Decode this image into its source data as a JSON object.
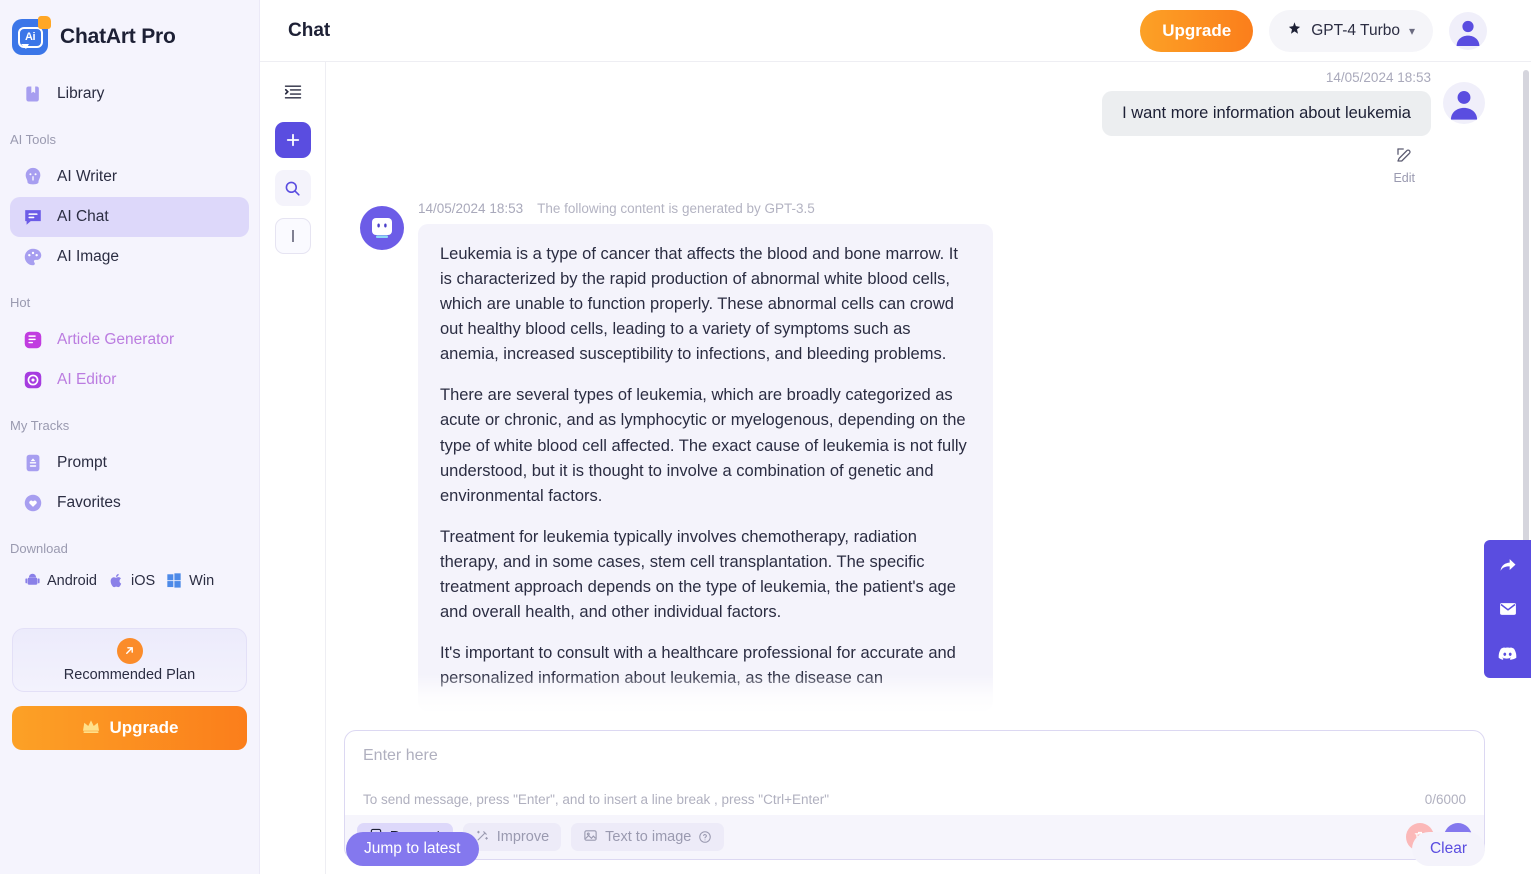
{
  "brand": {
    "name": "ChatArt Pro",
    "logo_text": "Ai"
  },
  "sidebar": {
    "library": {
      "label": "Library",
      "icon": "book-icon"
    },
    "sections": [
      {
        "title": "AI Tools"
      },
      {
        "title": "Hot"
      },
      {
        "title": "My Tracks"
      },
      {
        "title": "Download"
      }
    ],
    "ai_tools": [
      {
        "label": "AI Writer",
        "icon": "writer-icon"
      },
      {
        "label": "AI Chat",
        "icon": "chat-icon"
      },
      {
        "label": "AI Image",
        "icon": "palette-icon"
      }
    ],
    "hot": [
      {
        "label": "Article Generator",
        "icon": "article-icon"
      },
      {
        "label": "AI Editor",
        "icon": "editor-icon"
      }
    ],
    "my_tracks": [
      {
        "label": "Prompt",
        "icon": "prompt-icon"
      },
      {
        "label": "Favorites",
        "icon": "heart-icon"
      }
    ],
    "download": [
      {
        "label": "Android",
        "icon": "android-icon"
      },
      {
        "label": "iOS",
        "icon": "apple-icon"
      },
      {
        "label": "Win",
        "icon": "windows-icon"
      }
    ],
    "recommended_plan": {
      "label": "Recommended Plan",
      "icon": "arrow-up-right-icon"
    },
    "upgrade": {
      "label": "Upgrade",
      "icon": "crown-icon"
    }
  },
  "topbar": {
    "title": "Chat",
    "upgrade_label": "Upgrade",
    "model": "GPT-4 Turbo",
    "model_icon": "spark-icon",
    "chevron": "▾",
    "avatar": "user-avatar"
  },
  "rail": {
    "collapse": "collapse-panel-icon",
    "new_chat": "plus-icon",
    "search": "search-icon",
    "text_cursor": "text-cursor-icon"
  },
  "conversation": {
    "user_message": {
      "timestamp": "14/05/2024 18:53",
      "text": "I want more information about leukemia",
      "edit_label": "Edit"
    },
    "bot_message": {
      "timestamp": "14/05/2024 18:53",
      "generated_by": "The following content is generated by GPT-3.5",
      "paragraphs": [
        "Leukemia is a type of cancer that affects the blood and bone marrow. It is characterized by the rapid production of abnormal white blood cells, which are unable to function properly. These abnormal cells can crowd out healthy blood cells, leading to a variety of symptoms such as anemia, increased susceptibility to infections, and bleeding problems.",
        "There are several types of leukemia, which are broadly categorized as acute or chronic, and as lymphocytic or myelogenous, depending on the type of white blood cell affected. The exact cause of leukemia is not fully understood, but it is thought to involve a combination of genetic and environmental factors.",
        "Treatment for leukemia typically involves chemotherapy, radiation therapy, and in some cases, stem cell transplantation. The specific treatment approach depends on the type of leukemia, the patient's age and overall health, and other individual factors.",
        "It's important to consult with a healthcare professional for accurate and personalized information about leukemia, as the disease can"
      ]
    },
    "jump_to_latest": "Jump to latest",
    "clear": "Clear"
  },
  "composer": {
    "placeholder": "Enter here",
    "value": "",
    "hint": "To send message, press \"Enter\", and to insert a line break , press \"Ctrl+Enter\"",
    "counter": "0/6000",
    "chips": [
      {
        "label": "Prompt",
        "icon": "prompt-chip-icon"
      },
      {
        "label": "Improve",
        "icon": "wand-icon"
      },
      {
        "label": "Text to image",
        "icon": "image-icon",
        "help": "?"
      }
    ],
    "delete_icon": "trash-icon",
    "send_icon": "send-icon"
  },
  "dock": [
    {
      "icon": "share-icon"
    },
    {
      "icon": "mail-icon"
    },
    {
      "icon": "discord-icon"
    }
  ],
  "colors": {
    "accent": "#5a4de0",
    "accent_soft": "#ddd8fa",
    "orange": "#fb8c2a",
    "sidebar_bg": "#f5f4fd",
    "bot_bubble": "#f4f3fb",
    "user_bubble": "#eceef0",
    "hot_text": "#bb7ce0"
  }
}
